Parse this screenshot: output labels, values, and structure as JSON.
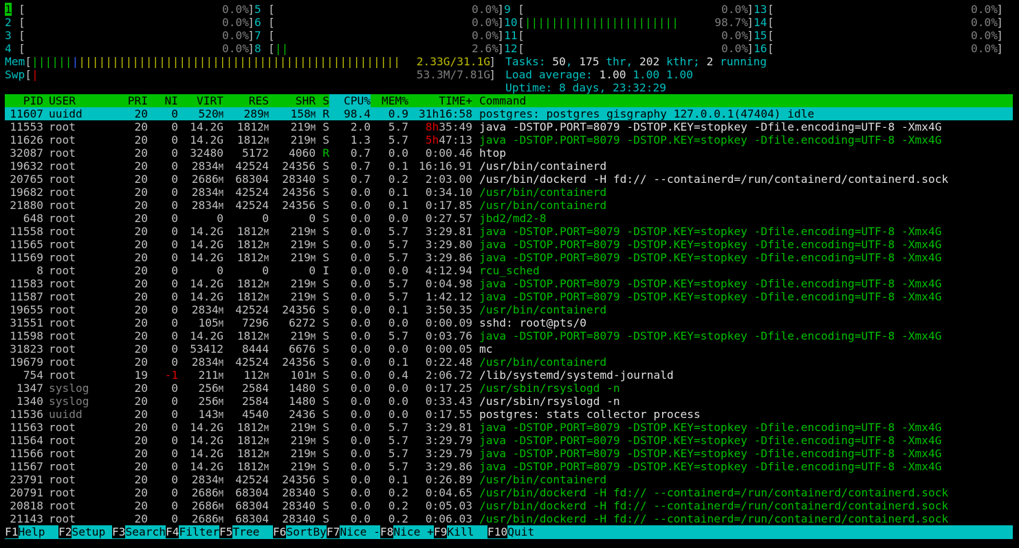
{
  "cpus": [
    {
      "n": "1",
      "bar": "",
      "pct": "0.0%"
    },
    {
      "n": "5",
      "bar": "",
      "pct": "0.0%"
    },
    {
      "n": "9",
      "bar": "",
      "pct": "0.0%"
    },
    {
      "n": "13",
      "bar": "",
      "pct": "0.0%"
    },
    {
      "n": "2",
      "bar": "",
      "pct": "0.0%"
    },
    {
      "n": "6",
      "bar": "",
      "pct": "0.0%"
    },
    {
      "n": "10",
      "bar": "|||||||||||||||||||||||",
      "pct": "98.7%"
    },
    {
      "n": "14",
      "bar": "",
      "pct": "0.0%"
    },
    {
      "n": "3",
      "bar": "",
      "pct": "0.0%"
    },
    {
      "n": "7",
      "bar": "",
      "pct": "0.0%"
    },
    {
      "n": "11",
      "bar": "",
      "pct": "0.0%"
    },
    {
      "n": "15",
      "bar": "",
      "pct": "0.0%"
    },
    {
      "n": "4",
      "bar": "",
      "pct": "0.0%"
    },
    {
      "n": "8",
      "bar": "||",
      "pct": "2.6%"
    },
    {
      "n": "12",
      "bar": "",
      "pct": "0.0%"
    },
    {
      "n": "16",
      "bar": "",
      "pct": "0.0%"
    }
  ],
  "mem": {
    "label": "Mem",
    "bar_green": "||||||",
    "bar_blue": "|",
    "bar_yellow": "||||||||||||||||||||||||||||||||||||||||||||||||",
    "value": "2.33G/31.1G"
  },
  "swp": {
    "label": "Swp",
    "bar": "|",
    "value": "53.3M/7.81G"
  },
  "tasks": {
    "label": "Tasks:",
    "count": "50",
    "thr": "175",
    "thr_label": "thr,",
    "kthr": "202",
    "kthr_label": "kthr;",
    "running": "2",
    "running_label": "running"
  },
  "load": {
    "label": "Load average:",
    "l1": "1.00",
    "l5": "1.00",
    "l15": "1.00"
  },
  "uptime": {
    "label": "Uptime:",
    "value": "8 days, 23:32:29"
  },
  "header": {
    "pid": "PID",
    "user": "USER",
    "pri": "PRI",
    "ni": "NI",
    "virt": "VIRT",
    "res": "RES",
    "shr": "SHR",
    "s": "S",
    "cpu": "CPU%",
    "mem": "MEM%",
    "time": "TIME+",
    "cmd": "Command"
  },
  "processes": [
    {
      "pid": "11607",
      "user": "uuidd",
      "pri": "20",
      "ni": "0",
      "virt": "520M",
      "res": "289M",
      "shr": "158M",
      "s": "R",
      "cpu": "98.4",
      "mem": "0.9",
      "time": "31h16:58",
      "cmd": "postgres: postgres gisgraphy 127.0.0.1(47404) idle",
      "selected": true
    },
    {
      "pid": "11553",
      "user": "root",
      "pri": "20",
      "ni": "0",
      "virt": "14.2G",
      "res": "1812M",
      "shr": "219M",
      "s": "S",
      "cpu": "2.0",
      "mem": "5.7",
      "time": "8h35:49",
      "cmd": "java -DSTOP.PORT=8079 -DSTOP.KEY=stopkey -Dfile.encoding=UTF-8 -Xmx4G"
    },
    {
      "pid": "11626",
      "user": "root",
      "pri": "20",
      "ni": "0",
      "virt": "14.2G",
      "res": "1812M",
      "shr": "219M",
      "s": "S",
      "cpu": "1.3",
      "mem": "5.7",
      "time": "5h47:13",
      "cmd": "java -DSTOP.PORT=8079 -DSTOP.KEY=stopkey -Dfile.encoding=UTF-8 -Xmx4G",
      "thread": true
    },
    {
      "pid": "32087",
      "user": "root",
      "pri": "20",
      "ni": "0",
      "virt": "32480",
      "res": "5172",
      "shr": "4060",
      "s": "R",
      "cpu": "0.7",
      "mem": "0.0",
      "time": "0:00.46",
      "cmd": "htop"
    },
    {
      "pid": "19632",
      "user": "root",
      "pri": "20",
      "ni": "0",
      "virt": "2834M",
      "res": "42524",
      "shr": "24356",
      "s": "S",
      "cpu": "0.7",
      "mem": "0.1",
      "time": "16:16.91",
      "cmd": "/usr/bin/containerd"
    },
    {
      "pid": "20765",
      "user": "root",
      "pri": "20",
      "ni": "0",
      "virt": "2686M",
      "res": "68304",
      "shr": "28340",
      "s": "S",
      "cpu": "0.7",
      "mem": "0.2",
      "time": "2:03.00",
      "cmd": "/usr/bin/dockerd -H fd:// --containerd=/run/containerd/containerd.sock"
    },
    {
      "pid": "19682",
      "user": "root",
      "pri": "20",
      "ni": "0",
      "virt": "2834M",
      "res": "42524",
      "shr": "24356",
      "s": "S",
      "cpu": "0.0",
      "mem": "0.1",
      "time": "0:34.10",
      "cmd": "/usr/bin/containerd",
      "thread": true
    },
    {
      "pid": "21880",
      "user": "root",
      "pri": "20",
      "ni": "0",
      "virt": "2834M",
      "res": "42524",
      "shr": "24356",
      "s": "S",
      "cpu": "0.0",
      "mem": "0.1",
      "time": "0:17.85",
      "cmd": "/usr/bin/containerd",
      "thread": true
    },
    {
      "pid": "648",
      "user": "root",
      "pri": "20",
      "ni": "0",
      "virt": "0",
      "res": "0",
      "shr": "0",
      "s": "S",
      "cpu": "0.0",
      "mem": "0.0",
      "time": "0:27.57",
      "cmd": "jbd2/md2-8",
      "thread": true
    },
    {
      "pid": "11558",
      "user": "root",
      "pri": "20",
      "ni": "0",
      "virt": "14.2G",
      "res": "1812M",
      "shr": "219M",
      "s": "S",
      "cpu": "0.0",
      "mem": "5.7",
      "time": "3:29.81",
      "cmd": "java -DSTOP.PORT=8079 -DSTOP.KEY=stopkey -Dfile.encoding=UTF-8 -Xmx4G",
      "thread": true
    },
    {
      "pid": "11565",
      "user": "root",
      "pri": "20",
      "ni": "0",
      "virt": "14.2G",
      "res": "1812M",
      "shr": "219M",
      "s": "S",
      "cpu": "0.0",
      "mem": "5.7",
      "time": "3:29.80",
      "cmd": "java -DSTOP.PORT=8079 -DSTOP.KEY=stopkey -Dfile.encoding=UTF-8 -Xmx4G",
      "thread": true
    },
    {
      "pid": "11569",
      "user": "root",
      "pri": "20",
      "ni": "0",
      "virt": "14.2G",
      "res": "1812M",
      "shr": "219M",
      "s": "S",
      "cpu": "0.0",
      "mem": "5.7",
      "time": "3:29.86",
      "cmd": "java -DSTOP.PORT=8079 -DSTOP.KEY=stopkey -Dfile.encoding=UTF-8 -Xmx4G",
      "thread": true
    },
    {
      "pid": "8",
      "user": "root",
      "pri": "20",
      "ni": "0",
      "virt": "0",
      "res": "0",
      "shr": "0",
      "s": "I",
      "cpu": "0.0",
      "mem": "0.0",
      "time": "4:12.94",
      "cmd": "rcu_sched",
      "thread": true
    },
    {
      "pid": "11583",
      "user": "root",
      "pri": "20",
      "ni": "0",
      "virt": "14.2G",
      "res": "1812M",
      "shr": "219M",
      "s": "S",
      "cpu": "0.0",
      "mem": "5.7",
      "time": "0:04.98",
      "cmd": "java -DSTOP.PORT=8079 -DSTOP.KEY=stopkey -Dfile.encoding=UTF-8 -Xmx4G",
      "thread": true
    },
    {
      "pid": "11587",
      "user": "root",
      "pri": "20",
      "ni": "0",
      "virt": "14.2G",
      "res": "1812M",
      "shr": "219M",
      "s": "S",
      "cpu": "0.0",
      "mem": "5.7",
      "time": "1:42.12",
      "cmd": "java -DSTOP.PORT=8079 -DSTOP.KEY=stopkey -Dfile.encoding=UTF-8 -Xmx4G",
      "thread": true
    },
    {
      "pid": "19655",
      "user": "root",
      "pri": "20",
      "ni": "0",
      "virt": "2834M",
      "res": "42524",
      "shr": "24356",
      "s": "S",
      "cpu": "0.0",
      "mem": "0.1",
      "time": "3:50.35",
      "cmd": "/usr/bin/containerd",
      "thread": true
    },
    {
      "pid": "31551",
      "user": "root",
      "pri": "20",
      "ni": "0",
      "virt": "105M",
      "res": "7296",
      "shr": "6272",
      "s": "S",
      "cpu": "0.0",
      "mem": "0.0",
      "time": "0:00.09",
      "cmd": "sshd: root@pts/0"
    },
    {
      "pid": "11598",
      "user": "root",
      "pri": "20",
      "ni": "0",
      "virt": "14.2G",
      "res": "1812M",
      "shr": "219M",
      "s": "S",
      "cpu": "0.0",
      "mem": "5.7",
      "time": "0:03.76",
      "cmd": "java -DSTOP.PORT=8079 -DSTOP.KEY=stopkey -Dfile.encoding=UTF-8 -Xmx4G",
      "thread": true
    },
    {
      "pid": "31823",
      "user": "root",
      "pri": "20",
      "ni": "0",
      "virt": "53412",
      "res": "8444",
      "shr": "6676",
      "s": "S",
      "cpu": "0.0",
      "mem": "0.0",
      "time": "0:00.05",
      "cmd": "mc"
    },
    {
      "pid": "19679",
      "user": "root",
      "pri": "20",
      "ni": "0",
      "virt": "2834M",
      "res": "42524",
      "shr": "24356",
      "s": "S",
      "cpu": "0.0",
      "mem": "0.1",
      "time": "0:22.48",
      "cmd": "/usr/bin/containerd",
      "thread": true
    },
    {
      "pid": "754",
      "user": "root",
      "pri": "19",
      "ni": "-1",
      "virt": "211M",
      "res": "112M",
      "shr": "101M",
      "s": "S",
      "cpu": "0.0",
      "mem": "0.4",
      "time": "2:06.72",
      "cmd": "/lib/systemd/systemd-journald"
    },
    {
      "pid": "1347",
      "user": "syslog",
      "pri": "20",
      "ni": "0",
      "virt": "256M",
      "res": "2584",
      "shr": "1480",
      "s": "S",
      "cpu": "0.0",
      "mem": "0.0",
      "time": "0:17.25",
      "cmd": "/usr/sbin/rsyslogd -n",
      "thread": true
    },
    {
      "pid": "1340",
      "user": "syslog",
      "pri": "20",
      "ni": "0",
      "virt": "256M",
      "res": "2584",
      "shr": "1480",
      "s": "S",
      "cpu": "0.0",
      "mem": "0.0",
      "time": "0:33.43",
      "cmd": "/usr/sbin/rsyslogd -n"
    },
    {
      "pid": "11536",
      "user": "uuidd",
      "pri": "20",
      "ni": "0",
      "virt": "143M",
      "res": "4540",
      "shr": "2436",
      "s": "S",
      "cpu": "0.0",
      "mem": "0.0",
      "time": "0:17.55",
      "cmd": "postgres: stats collector process"
    },
    {
      "pid": "11563",
      "user": "root",
      "pri": "20",
      "ni": "0",
      "virt": "14.2G",
      "res": "1812M",
      "shr": "219M",
      "s": "S",
      "cpu": "0.0",
      "mem": "5.7",
      "time": "3:29.81",
      "cmd": "java -DSTOP.PORT=8079 -DSTOP.KEY=stopkey -Dfile.encoding=UTF-8 -Xmx4G",
      "thread": true
    },
    {
      "pid": "11564",
      "user": "root",
      "pri": "20",
      "ni": "0",
      "virt": "14.2G",
      "res": "1812M",
      "shr": "219M",
      "s": "S",
      "cpu": "0.0",
      "mem": "5.7",
      "time": "3:29.79",
      "cmd": "java -DSTOP.PORT=8079 -DSTOP.KEY=stopkey -Dfile.encoding=UTF-8 -Xmx4G",
      "thread": true
    },
    {
      "pid": "11566",
      "user": "root",
      "pri": "20",
      "ni": "0",
      "virt": "14.2G",
      "res": "1812M",
      "shr": "219M",
      "s": "S",
      "cpu": "0.0",
      "mem": "5.7",
      "time": "3:29.79",
      "cmd": "java -DSTOP.PORT=8079 -DSTOP.KEY=stopkey -Dfile.encoding=UTF-8 -Xmx4G",
      "thread": true
    },
    {
      "pid": "11567",
      "user": "root",
      "pri": "20",
      "ni": "0",
      "virt": "14.2G",
      "res": "1812M",
      "shr": "219M",
      "s": "S",
      "cpu": "0.0",
      "mem": "5.7",
      "time": "3:29.86",
      "cmd": "java -DSTOP.PORT=8079 -DSTOP.KEY=stopkey -Dfile.encoding=UTF-8 -Xmx4G",
      "thread": true
    },
    {
      "pid": "23791",
      "user": "root",
      "pri": "20",
      "ni": "0",
      "virt": "2834M",
      "res": "42524",
      "shr": "24356",
      "s": "S",
      "cpu": "0.0",
      "mem": "0.1",
      "time": "0:26.89",
      "cmd": "/usr/bin/containerd",
      "thread": true
    },
    {
      "pid": "20791",
      "user": "root",
      "pri": "20",
      "ni": "0",
      "virt": "2686M",
      "res": "68304",
      "shr": "28340",
      "s": "S",
      "cpu": "0.0",
      "mem": "0.2",
      "time": "0:04.65",
      "cmd": "/usr/bin/dockerd -H fd:// --containerd=/run/containerd/containerd.sock",
      "thread": true
    },
    {
      "pid": "20818",
      "user": "root",
      "pri": "20",
      "ni": "0",
      "virt": "2686M",
      "res": "68304",
      "shr": "28340",
      "s": "S",
      "cpu": "0.0",
      "mem": "0.2",
      "time": "0:05.03",
      "cmd": "/usr/bin/dockerd -H fd:// --containerd=/run/containerd/containerd.sock",
      "thread": true
    },
    {
      "pid": "21143",
      "user": "root",
      "pri": "20",
      "ni": "0",
      "virt": "2686M",
      "res": "68304",
      "shr": "28340",
      "s": "S",
      "cpu": "0.0",
      "mem": "0.2",
      "time": "0:06.03",
      "cmd": "/usr/bin/dockerd -H fd:// --containerd=/run/containerd/containerd.sock",
      "thread": true
    }
  ],
  "footer": [
    {
      "key": "F1",
      "label": "Help  "
    },
    {
      "key": "F2",
      "label": "Setup "
    },
    {
      "key": "F3",
      "label": "Search"
    },
    {
      "key": "F4",
      "label": "Filter"
    },
    {
      "key": "F5",
      "label": "Tree  "
    },
    {
      "key": "F6",
      "label": "SortBy"
    },
    {
      "key": "F7",
      "label": "Nice -"
    },
    {
      "key": "F8",
      "label": "Nice +"
    },
    {
      "key": "F9",
      "label": "Kill  "
    },
    {
      "key": "F10",
      "label": "Quit"
    }
  ],
  "colors": {
    "cyan": "#00c0c0",
    "green": "#00c000",
    "red": "#e00000",
    "yellow": "#c0c000",
    "blue": "#3060ff",
    "gray": "#808080"
  }
}
